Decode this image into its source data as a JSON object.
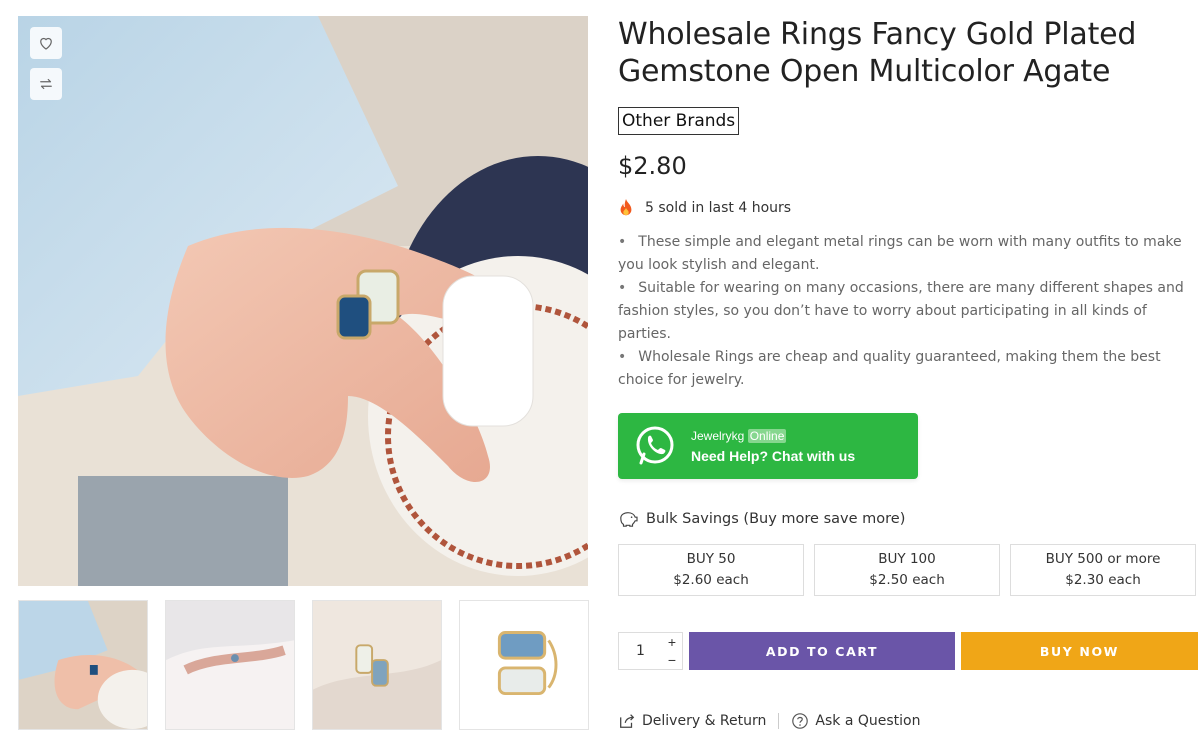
{
  "product": {
    "title": "Wholesale Rings Fancy Gold Plated Gemstone Open Multicolor Agate",
    "brand": "Other Brands",
    "price": "$2.80",
    "sold_text": "5 sold in last 4 hours",
    "description": [
      "These simple and elegant metal rings can be worn with many outfits to make you look stylish and elegant.",
      "Suitable for wearing on many occasions, there are many different shapes and fashion styles, so you don’t have to worry about participating in all kinds of parties.",
      "Wholesale Rings are cheap and quality guaranteed, making them the best choice for jewelry."
    ]
  },
  "gallery": {
    "actions": [
      "heart-icon",
      "compare-icon"
    ],
    "thumbnails": 4
  },
  "whatsapp": {
    "agent": "Jewelrykg",
    "status": "Online",
    "cta": "Need Help? Chat with us",
    "color": "#2db742"
  },
  "bulk": {
    "heading": "Bulk Savings (Buy more save more)",
    "tiers": [
      {
        "qty": "BUY 50",
        "price": "$2.60 each"
      },
      {
        "qty": "BUY 100",
        "price": "$2.50 each"
      },
      {
        "qty": "BUY 500 or more",
        "price": "$2.30 each"
      }
    ]
  },
  "cart": {
    "quantity": "1",
    "plus": "+",
    "minus": "−",
    "add_to_cart": "ADD TO CART",
    "buy_now": "BUY NOW",
    "add_color": "#6a55a8",
    "buy_color": "#f0a617"
  },
  "links": {
    "delivery": "Delivery & Return",
    "ask": "Ask a Question"
  }
}
